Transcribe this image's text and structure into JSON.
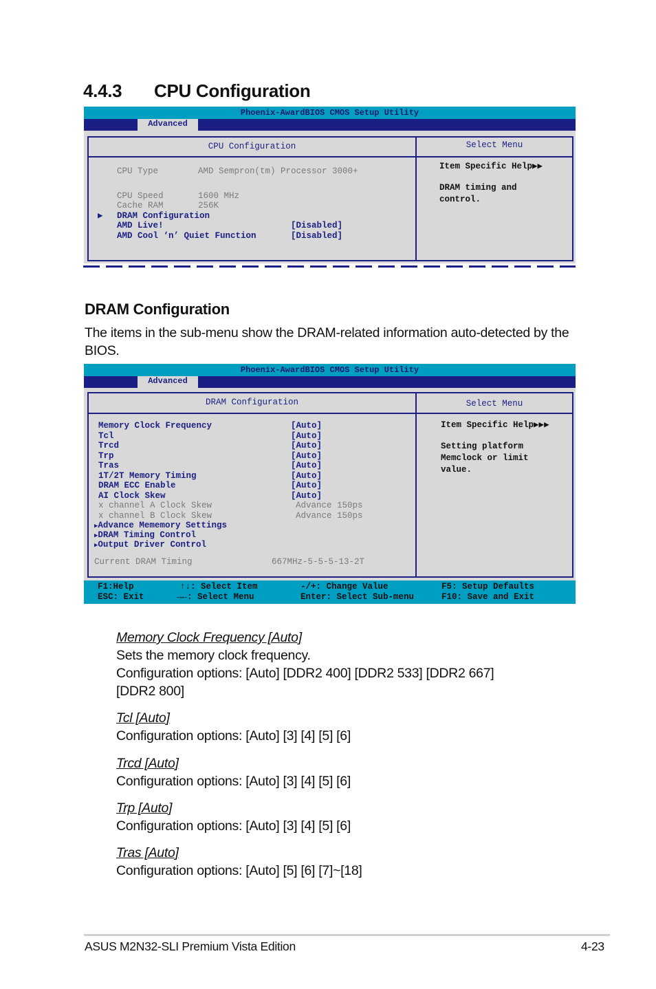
{
  "section": {
    "number": "4.4.3",
    "title": "CPU Configuration"
  },
  "bios1": {
    "title": "Phoenix-AwardBIOS CMOS Setup Utility",
    "tab": "Advanced",
    "panel_title": "CPU Configuration",
    "help_title": "Select Menu",
    "info": [
      {
        "label": "CPU Type",
        "value": "AMD Sempron(tm) Processor 3000+"
      },
      {
        "label": "CPU Speed",
        "value": "1600 MHz"
      },
      {
        "label": "Cache RAM",
        "value": "256K"
      }
    ],
    "items": [
      {
        "label": "DRAM Configuration",
        "value": "",
        "submenu": true
      },
      {
        "label": "AMD Live!",
        "value": "[Disabled]"
      },
      {
        "label": "AMD Cool ‘n’ Quiet Function",
        "value": "[Disabled]"
      }
    ],
    "help_heading": "Item Specific Help",
    "help_arrows": "▶▶",
    "help_lines": [
      "DRAM timing and",
      "control."
    ]
  },
  "dram_section": {
    "title": "DRAM Configuration",
    "intro": "The items in the sub-menu show the DRAM-related information auto-detected by the BIOS."
  },
  "bios2": {
    "title": "Phoenix-AwardBIOS CMOS Setup Utility",
    "tab": "Advanced",
    "panel_title": "DRAM Configuration",
    "help_title": "Select Menu",
    "items": [
      {
        "label": "Memory Clock Frequency",
        "value": "[Auto]"
      },
      {
        "label": "Tcl",
        "value": "[Auto]"
      },
      {
        "label": "Trcd",
        "value": "[Auto]"
      },
      {
        "label": "Trp",
        "value": "[Auto]"
      },
      {
        "label": "Tras",
        "value": "[Auto]"
      },
      {
        "label": "1T/2T Memory Timing",
        "value": "[Auto]"
      },
      {
        "label": "DRAM ECC Enable",
        "value": "[Auto]"
      },
      {
        "label": "AI Clock Skew",
        "value": "[Auto]"
      }
    ],
    "disabled_items": [
      {
        "label": "x channel A Clock Skew",
        "value": "Advance 150ps"
      },
      {
        "label": "x channel B Clock Skew",
        "value": "Advance 150ps"
      }
    ],
    "submenus": [
      "Advance Mememory Settings",
      "DRAM Timing Control",
      "Output Driver Control"
    ],
    "current_timing": {
      "label": "Current DRAM Timing",
      "value": "667MHz-5-5-5-13-2T"
    },
    "help_heading": "Item Specific Help",
    "help_arrows": "▶▶▶",
    "help_lines": [
      "Setting platform",
      "Memclock or limit",
      "value."
    ],
    "keys": [
      [
        "F1:Help",
        "↑↓: Select Item",
        "-/+: Change Value",
        "F5: Setup Defaults"
      ],
      [
        "ESC: Exit",
        "→←: Select Menu",
        "Enter: Select Sub-menu",
        "F10: Save and Exit"
      ]
    ]
  },
  "options": [
    {
      "name": "Memory Clock Frequency [Auto]",
      "lines": [
        "Sets the memory clock frequency.",
        "Configuration options: [Auto] [DDR2 400] [DDR2 533] [DDR2 667]",
        "[DDR2 800]"
      ]
    },
    {
      "name": "Tcl [Auto]",
      "lines": [
        "Configuration options: [Auto] [3] [4] [5] [6]"
      ]
    },
    {
      "name": "Trcd [Auto]",
      "lines": [
        "Configuration options: [Auto] [3] [4] [5] [6]"
      ]
    },
    {
      "name": "Trp [Auto]",
      "lines": [
        "Configuration options: [Auto] [3] [4] [5] [6]"
      ]
    },
    {
      "name": "Tras [Auto]",
      "lines": [
        "Configuration options: [Auto] [5] [6] [7]~[18]"
      ]
    }
  ],
  "footer": {
    "left": "ASUS M2N32-SLI Premium Vista Edition",
    "right": "4-23"
  }
}
